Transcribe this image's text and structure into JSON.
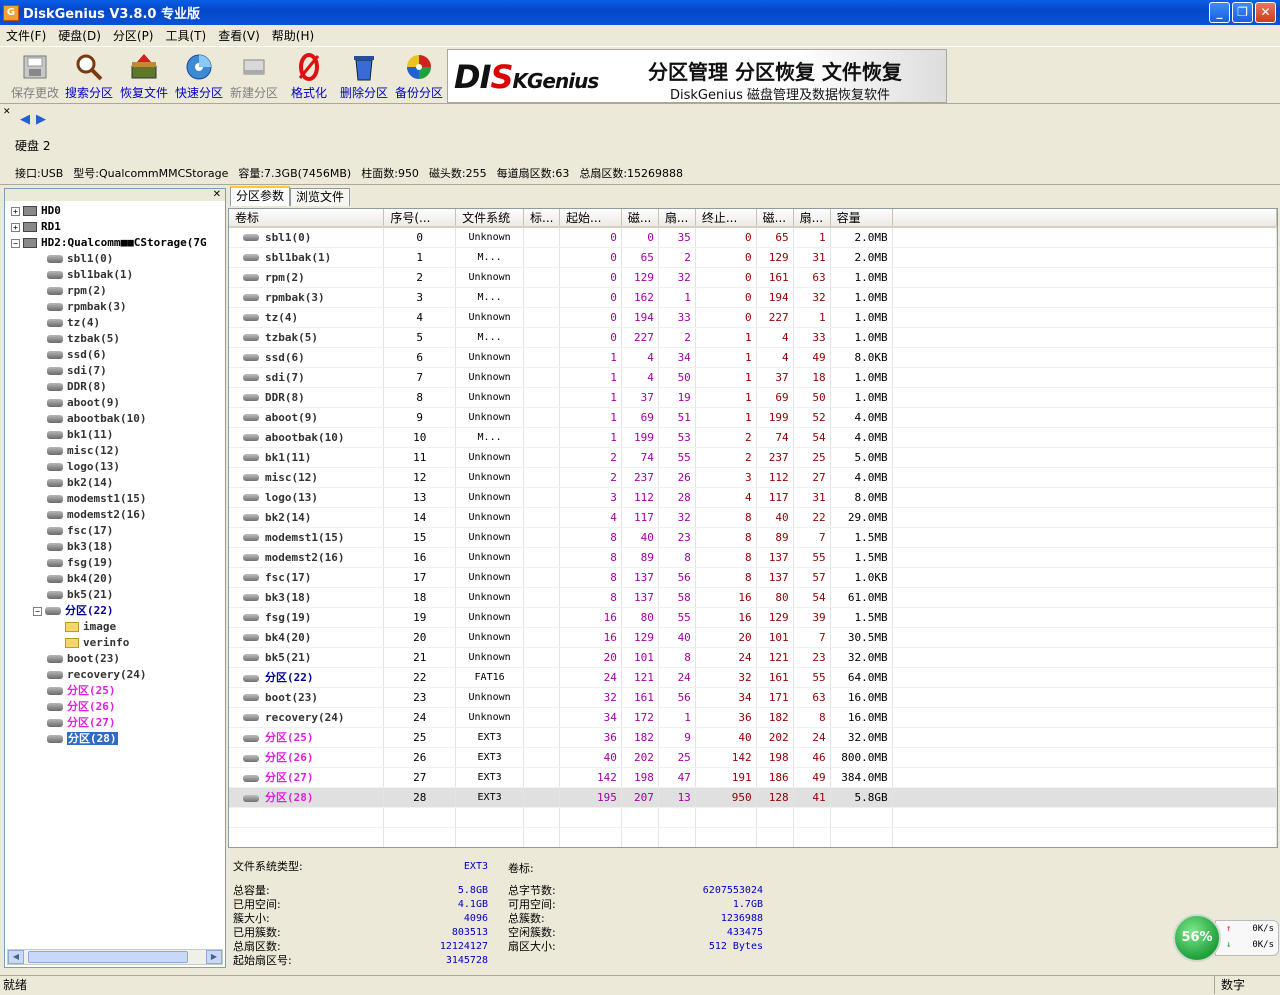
{
  "window": {
    "title": "DiskGenius V3.8.0 专业版",
    "icon": "G",
    "min": "_",
    "max": "❐",
    "close": "✕"
  },
  "menu": [
    "文件(F)",
    "硬盘(D)",
    "分区(P)",
    "工具(T)",
    "查看(V)",
    "帮助(H)"
  ],
  "toolbar": [
    {
      "label": "保存更改",
      "icon": "save-icon",
      "disabled": true
    },
    {
      "label": "搜索分区",
      "icon": "search-icon",
      "disabled": false
    },
    {
      "label": "恢复文件",
      "icon": "recover-icon",
      "disabled": false
    },
    {
      "label": "快速分区",
      "icon": "quick-partition-icon",
      "disabled": false
    },
    {
      "label": "新建分区",
      "icon": "new-partition-icon",
      "disabled": true
    },
    {
      "label": "格式化",
      "icon": "format-icon",
      "disabled": false
    },
    {
      "label": "删除分区",
      "icon": "delete-icon",
      "disabled": false
    },
    {
      "label": "备份分区",
      "icon": "backup-icon",
      "disabled": false
    }
  ],
  "banner": {
    "logo_a": "DI",
    "logo_b": "S",
    "logo_c": "KGenius",
    "slogan": "分区管理 分区恢复 文件恢复",
    "subtitle": "DiskGenius 磁盘管理及数据恢复软件"
  },
  "disk": {
    "name": "硬盘 2",
    "info": [
      "接口:USB",
      "型号:QualcommMMCStorage",
      "容量:7.3GB(7456MB)",
      "柱面数:950",
      "磁头数:255",
      "每道扇区数:63",
      "总扇区数:15269888"
    ]
  },
  "tree": [
    {
      "label": "HD0",
      "level": 0,
      "kind": "disk",
      "expander": "+"
    },
    {
      "label": "RD1",
      "level": 0,
      "kind": "disk",
      "expander": "+"
    },
    {
      "label": "HD2:Qualcomm■■CStorage(7G",
      "level": 0,
      "kind": "disk",
      "expander": "−"
    },
    {
      "label": "sbl1(0)",
      "level": 1,
      "kind": "part"
    },
    {
      "label": "sbl1bak(1)",
      "level": 1,
      "kind": "part"
    },
    {
      "label": "rpm(2)",
      "level": 1,
      "kind": "part"
    },
    {
      "label": "rpmbak(3)",
      "level": 1,
      "kind": "part"
    },
    {
      "label": "tz(4)",
      "level": 1,
      "kind": "part"
    },
    {
      "label": "tzbak(5)",
      "level": 1,
      "kind": "part"
    },
    {
      "label": "ssd(6)",
      "level": 1,
      "kind": "part"
    },
    {
      "label": "sdi(7)",
      "level": 1,
      "kind": "part"
    },
    {
      "label": "DDR(8)",
      "level": 1,
      "kind": "part"
    },
    {
      "label": "aboot(9)",
      "level": 1,
      "kind": "part"
    },
    {
      "label": "abootbak(10)",
      "level": 1,
      "kind": "part"
    },
    {
      "label": "bk1(11)",
      "level": 1,
      "kind": "part"
    },
    {
      "label": "misc(12)",
      "level": 1,
      "kind": "part"
    },
    {
      "label": "logo(13)",
      "level": 1,
      "kind": "part"
    },
    {
      "label": "bk2(14)",
      "level": 1,
      "kind": "part"
    },
    {
      "label": "modemst1(15)",
      "level": 1,
      "kind": "part"
    },
    {
      "label": "modemst2(16)",
      "level": 1,
      "kind": "part"
    },
    {
      "label": "fsc(17)",
      "level": 1,
      "kind": "part"
    },
    {
      "label": "bk3(18)",
      "level": 1,
      "kind": "part"
    },
    {
      "label": "fsg(19)",
      "level": 1,
      "kind": "part"
    },
    {
      "label": "bk4(20)",
      "level": 1,
      "kind": "part"
    },
    {
      "label": "bk5(21)",
      "level": 1,
      "kind": "part"
    },
    {
      "label": "分区(22)",
      "level": 1,
      "kind": "part",
      "color": "navy",
      "expander": "−"
    },
    {
      "label": "image",
      "level": 2,
      "kind": "folder"
    },
    {
      "label": "verinfo",
      "level": 2,
      "kind": "folder"
    },
    {
      "label": "boot(23)",
      "level": 1,
      "kind": "part"
    },
    {
      "label": "recovery(24)",
      "level": 1,
      "kind": "part"
    },
    {
      "label": "分区(25)",
      "level": 1,
      "kind": "part",
      "color": "magenta"
    },
    {
      "label": "分区(26)",
      "level": 1,
      "kind": "part",
      "color": "magenta"
    },
    {
      "label": "分区(27)",
      "level": 1,
      "kind": "part",
      "color": "magenta"
    },
    {
      "label": "分区(28)",
      "level": 1,
      "kind": "part",
      "selected": true
    }
  ],
  "tabs": [
    "分区参数",
    "浏览文件"
  ],
  "columns": [
    "卷标",
    "序号(...",
    "文件系统",
    "标...",
    "起始...",
    "磁...",
    "扇...",
    "终止...",
    "磁...",
    "扇...",
    "容量"
  ],
  "rows": [
    [
      "sbl1(0)",
      "0",
      "Unknown",
      "",
      "0",
      "0",
      "35",
      "0",
      "65",
      "1",
      "2.0MB"
    ],
    [
      "sbl1bak(1)",
      "1",
      "M...",
      "",
      "0",
      "65",
      "2",
      "0",
      "129",
      "31",
      "2.0MB"
    ],
    [
      "rpm(2)",
      "2",
      "Unknown",
      "",
      "0",
      "129",
      "32",
      "0",
      "161",
      "63",
      "1.0MB"
    ],
    [
      "rpmbak(3)",
      "3",
      "M...",
      "",
      "0",
      "162",
      "1",
      "0",
      "194",
      "32",
      "1.0MB"
    ],
    [
      "tz(4)",
      "4",
      "Unknown",
      "",
      "0",
      "194",
      "33",
      "0",
      "227",
      "1",
      "1.0MB"
    ],
    [
      "tzbak(5)",
      "5",
      "M...",
      "",
      "0",
      "227",
      "2",
      "1",
      "4",
      "33",
      "1.0MB"
    ],
    [
      "ssd(6)",
      "6",
      "Unknown",
      "",
      "1",
      "4",
      "34",
      "1",
      "4",
      "49",
      "8.0KB"
    ],
    [
      "sdi(7)",
      "7",
      "Unknown",
      "",
      "1",
      "4",
      "50",
      "1",
      "37",
      "18",
      "1.0MB"
    ],
    [
      "DDR(8)",
      "8",
      "Unknown",
      "",
      "1",
      "37",
      "19",
      "1",
      "69",
      "50",
      "1.0MB"
    ],
    [
      "aboot(9)",
      "9",
      "Unknown",
      "",
      "1",
      "69",
      "51",
      "1",
      "199",
      "52",
      "4.0MB"
    ],
    [
      "abootbak(10)",
      "10",
      "M...",
      "",
      "1",
      "199",
      "53",
      "2",
      "74",
      "54",
      "4.0MB"
    ],
    [
      "bk1(11)",
      "11",
      "Unknown",
      "",
      "2",
      "74",
      "55",
      "2",
      "237",
      "25",
      "5.0MB"
    ],
    [
      "misc(12)",
      "12",
      "Unknown",
      "",
      "2",
      "237",
      "26",
      "3",
      "112",
      "27",
      "4.0MB"
    ],
    [
      "logo(13)",
      "13",
      "Unknown",
      "",
      "3",
      "112",
      "28",
      "4",
      "117",
      "31",
      "8.0MB"
    ],
    [
      "bk2(14)",
      "14",
      "Unknown",
      "",
      "4",
      "117",
      "32",
      "8",
      "40",
      "22",
      "29.0MB"
    ],
    [
      "modemst1(15)",
      "15",
      "Unknown",
      "",
      "8",
      "40",
      "23",
      "8",
      "89",
      "7",
      "1.5MB"
    ],
    [
      "modemst2(16)",
      "16",
      "Unknown",
      "",
      "8",
      "89",
      "8",
      "8",
      "137",
      "55",
      "1.5MB"
    ],
    [
      "fsc(17)",
      "17",
      "Unknown",
      "",
      "8",
      "137",
      "56",
      "8",
      "137",
      "57",
      "1.0KB"
    ],
    [
      "bk3(18)",
      "18",
      "Unknown",
      "",
      "8",
      "137",
      "58",
      "16",
      "80",
      "54",
      "61.0MB"
    ],
    [
      "fsg(19)",
      "19",
      "Unknown",
      "",
      "16",
      "80",
      "55",
      "16",
      "129",
      "39",
      "1.5MB"
    ],
    [
      "bk4(20)",
      "20",
      "Unknown",
      "",
      "16",
      "129",
      "40",
      "20",
      "101",
      "7",
      "30.5MB"
    ],
    [
      "bk5(21)",
      "21",
      "Unknown",
      "",
      "20",
      "101",
      "8",
      "24",
      "121",
      "23",
      "32.0MB"
    ],
    [
      "分区(22)",
      "22",
      "FAT16",
      "",
      "24",
      "121",
      "24",
      "32",
      "161",
      "55",
      "64.0MB"
    ],
    [
      "boot(23)",
      "23",
      "Unknown",
      "",
      "32",
      "161",
      "56",
      "34",
      "171",
      "63",
      "16.0MB"
    ],
    [
      "recovery(24)",
      "24",
      "Unknown",
      "",
      "34",
      "172",
      "1",
      "36",
      "182",
      "8",
      "16.0MB"
    ],
    [
      "分区(25)",
      "25",
      "EXT3",
      "",
      "36",
      "182",
      "9",
      "40",
      "202",
      "24",
      "32.0MB"
    ],
    [
      "分区(26)",
      "26",
      "EXT3",
      "",
      "40",
      "202",
      "25",
      "142",
      "198",
      "46",
      "800.0MB"
    ],
    [
      "分区(27)",
      "27",
      "EXT3",
      "",
      "142",
      "198",
      "47",
      "191",
      "186",
      "49",
      "384.0MB"
    ],
    [
      "分区(28)",
      "28",
      "EXT3",
      "",
      "195",
      "207",
      "13",
      "950",
      "128",
      "41",
      "5.8GB"
    ]
  ],
  "row_styles": {
    "22": "navy",
    "25": "magenta",
    "26": "magenta",
    "27": "magenta",
    "28": "magenta-selected"
  },
  "fsinfo": {
    "fs_type_label": "文件系统类型:",
    "fs_type": "EXT3",
    "vol_label": "卷标:",
    "left": [
      [
        "总容量:",
        "5.8GB"
      ],
      [
        "已用空间:",
        "4.1GB"
      ],
      [
        "簇大小:",
        "4096"
      ],
      [
        "已用簇数:",
        "803513"
      ],
      [
        "总扇区数:",
        "12124127"
      ],
      [
        "起始扇区号:",
        "3145728"
      ]
    ],
    "right": [
      [
        "总字节数:",
        "6207553024"
      ],
      [
        "可用空间:",
        "1.7GB"
      ],
      [
        "总簇数:",
        "1236988"
      ],
      [
        "空闲簇数:",
        "433475"
      ],
      [
        "扇区大小:",
        "512 Bytes"
      ]
    ]
  },
  "status": {
    "left": "就绪",
    "right": "数字"
  },
  "net": {
    "percent": "56%",
    "up": "0K/s",
    "down": "0K/s"
  },
  "nav": {
    "back": "◀",
    "forward": "▶",
    "close_x": "✕",
    "expand_plus": "+",
    "up_arrow": "↑",
    "down_arrow": "↓"
  }
}
